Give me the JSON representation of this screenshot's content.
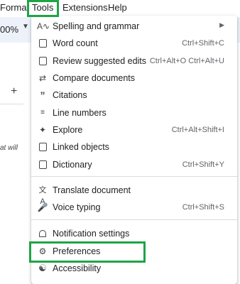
{
  "menubar": {
    "format": "Format",
    "tools": "Tools",
    "extensions": "Extensions",
    "help": "Help"
  },
  "toolbar": {
    "zoom": "00%"
  },
  "background": {
    "fragment_text": "at will"
  },
  "menu": {
    "items": [
      {
        "label": "Spelling and grammar",
        "shortcut": "",
        "icon": "spellcheck-icon",
        "submenu": true
      },
      {
        "label": "Word count",
        "shortcut": "Ctrl+Shift+C",
        "icon": "word-count-icon"
      },
      {
        "label": "Review suggested edits",
        "shortcut": "Ctrl+Alt+O Ctrl+Alt+U",
        "icon": "review-edits-icon"
      },
      {
        "label": "Compare documents",
        "shortcut": "",
        "icon": "compare-icon"
      },
      {
        "label": "Citations",
        "shortcut": "",
        "icon": "quote-icon"
      },
      {
        "label": "Line numbers",
        "shortcut": "",
        "icon": "line-numbers-icon"
      },
      {
        "label": "Explore",
        "shortcut": "Ctrl+Alt+Shift+I",
        "icon": "explore-icon"
      },
      {
        "label": "Linked objects",
        "shortcut": "",
        "icon": "link-icon"
      },
      {
        "label": "Dictionary",
        "shortcut": "Ctrl+Shift+Y",
        "icon": "dictionary-icon"
      },
      {
        "label": "Translate document",
        "shortcut": "",
        "icon": "translate-icon"
      },
      {
        "label": "Voice typing",
        "shortcut": "Ctrl+Shift+S",
        "icon": "microphone-icon"
      },
      {
        "label": "Notification settings",
        "shortcut": "",
        "icon": "bell-icon"
      },
      {
        "label": "Preferences",
        "shortcut": "",
        "icon": "preferences-icon"
      },
      {
        "label": "Accessibility",
        "shortcut": "",
        "icon": "accessibility-icon"
      }
    ]
  },
  "colors": {
    "highlight": "#1ea446",
    "toolbar_bg": "#edf2fa",
    "menu_bg": "#ffffff"
  }
}
